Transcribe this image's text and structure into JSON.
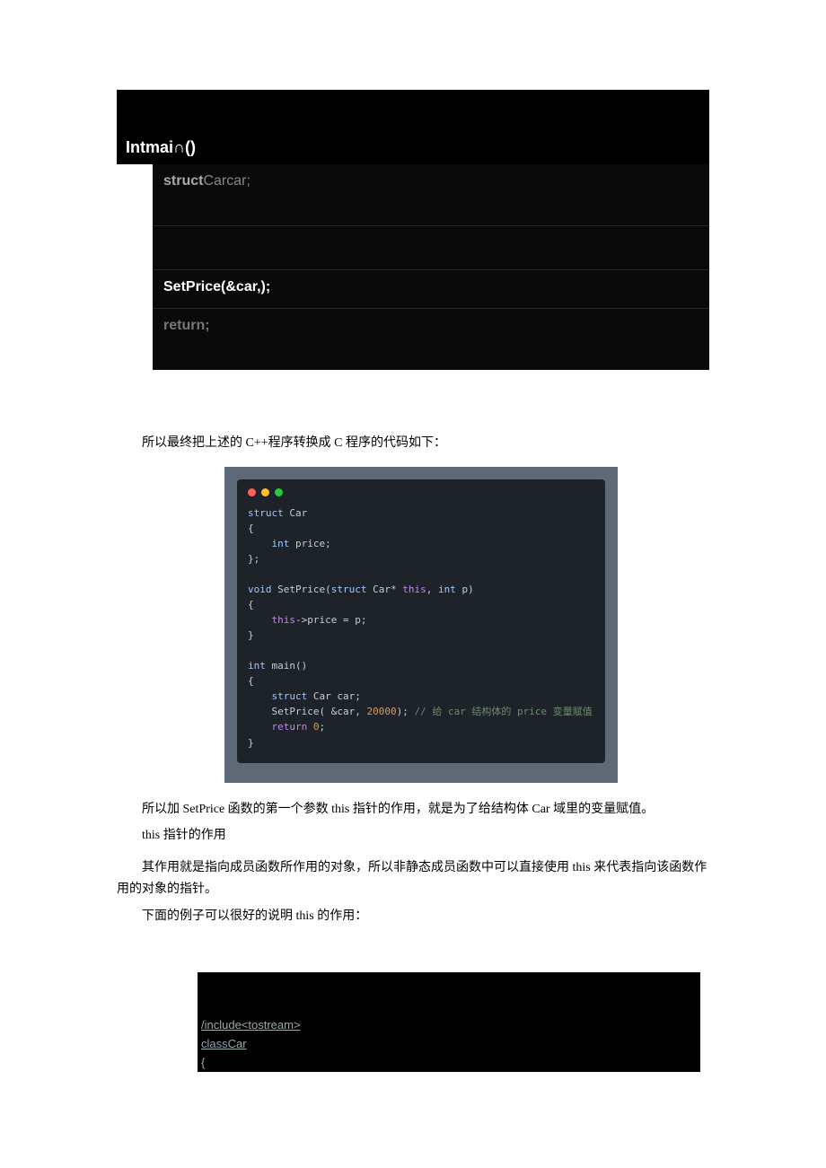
{
  "code1": {
    "title": "Intmai∩()",
    "line_struct_kw": "struct",
    "line_struct_rest": "Carcar;",
    "line_setprice": "SetPrice(&car,);",
    "line_return": "return;"
  },
  "para1": "所以最终把上述的 C++程序转换成 C 程序的代码如下：",
  "figure": {
    "l1a": "struct",
    "l1b": " Car",
    "l2": "{",
    "l3a": "    int",
    "l3b": " price;",
    "l4": "};",
    "l5": "",
    "l6a": "void",
    "l6b": " SetPrice(",
    "l6c": "struct",
    "l6d": " Car* ",
    "l6e": "this",
    "l6f": ", ",
    "l6g": "int",
    "l6h": " p)",
    "l7": "{",
    "l8a": "    this",
    "l8b": "->price = p;",
    "l9": "}",
    "l10": "",
    "l11a": "int",
    "l11b": " main()",
    "l12": "{",
    "l13a": "    struct",
    "l13b": " Car car;",
    "l14a": "    SetPrice( &car, ",
    "l14b": "20000",
    "l14c": "); ",
    "l14d": "// 给 car 结构体的 price 变量赋值",
    "l15a": "    return ",
    "l15b": "0",
    "l15c": ";",
    "l16": "}"
  },
  "para2": "所以加 SetPrice 函数的第一个参数 this 指针的作用，就是为了给结构体 Car 域里的变量赋值。",
  "para3": "this 指针的作用",
  "para4": "其作用就是指向成员函数所作用的对象，所以非静态成员函数中可以直接使用 this 来代表指向该函数作用的对象的指针。",
  "para5": "下面的例子可以很好的说明 this 的作用：",
  "code2": {
    "line_include": "/include<tostream>",
    "line_class_kw": "class",
    "line_class_rest": "Car",
    "line_brace": "{"
  }
}
